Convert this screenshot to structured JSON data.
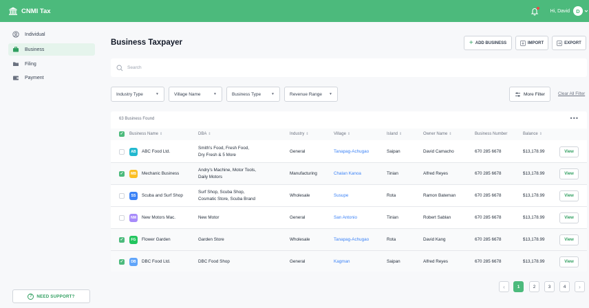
{
  "app": {
    "title": "CNMI Tax",
    "greeting": "Hi, David",
    "avatar_initial": "D",
    "accent": "#4cba7c"
  },
  "sidebar": {
    "items": [
      {
        "label": "Individual",
        "icon": "user-icon",
        "active": false
      },
      {
        "label": "Business",
        "icon": "briefcase-icon",
        "active": true
      },
      {
        "label": "Filing",
        "icon": "folder-icon",
        "active": false
      },
      {
        "label": "Payment",
        "icon": "wallet-icon",
        "active": false
      }
    ],
    "support_label": "NEED SUPPORT?"
  },
  "page": {
    "title": "Business Taxpayer",
    "add_label": "ADD BUSINESS",
    "import_label": "IMPORT",
    "export_label": "EXPORT"
  },
  "search": {
    "placeholder": "Search"
  },
  "filters": {
    "items": [
      "Industry Type",
      "Village Name",
      "Business Type",
      "Revenue Range"
    ],
    "more_label": "More Filter",
    "clear_label": "Clear All Filter"
  },
  "table": {
    "found_label": "63 Business Found",
    "columns": [
      "Business Name",
      "DBA",
      "Industry",
      "Village",
      "Island",
      "Owner Name",
      "Business Number",
      "Balance"
    ],
    "view_label": "View",
    "rows": [
      {
        "checked": false,
        "abbr": "AB",
        "abbr_color": "#22b8cf",
        "name": "ABC Food Ltd.",
        "dba1": "Smith's Food, Fresh Food,",
        "dba2": "Dry Fresh & 5 More",
        "industry": "General",
        "village": "Tanapag-Achugao",
        "island": "Saipan",
        "owner": "David Camacho",
        "number": "670 285 6678",
        "balance": "$13,178.99"
      },
      {
        "checked": true,
        "abbr": "MB",
        "abbr_color": "#fbbf24",
        "name": "Mechanic Business",
        "dba1": "Andry's Machine, Motor Tools,",
        "dba2": "Daily Motors",
        "industry": "Manufacturing",
        "village": "Chalan Kanoa",
        "island": "Tinian",
        "owner": "Alfred Reyes",
        "number": "670 285 6678",
        "balance": "$13,178.99"
      },
      {
        "checked": false,
        "abbr": "SS",
        "abbr_color": "#3b82f6",
        "name": "Scuba and Surf Shop",
        "dba1": "Surf Shop, Scuba Shop,",
        "dba2": "Cosmatic Store, Scuba Brand",
        "industry": "Wholesale",
        "village": "Susupe",
        "island": "Rota",
        "owner": "Ramon Bateman",
        "number": "670 285 6678",
        "balance": "$13,178.99"
      },
      {
        "checked": false,
        "abbr": "NM",
        "abbr_color": "#a78bfa",
        "name": "New Motors Mac.",
        "dba1": "New Motor",
        "dba2": "",
        "industry": "General",
        "village": "San Antonio",
        "island": "Tinian",
        "owner": "Robert Sablan",
        "number": "670 285 6678",
        "balance": "$13,178.99"
      },
      {
        "checked": true,
        "abbr": "FG",
        "abbr_color": "#22c55e",
        "name": "Flower Garden",
        "dba1": "Garden Store",
        "dba2": "",
        "industry": "Wholesale",
        "village": "Tanapag-Achugao",
        "island": "Rota",
        "owner": "David Kang",
        "number": "670 285 6678",
        "balance": "$13,178.99"
      },
      {
        "checked": true,
        "abbr": "DB",
        "abbr_color": "#60a5fa",
        "name": "DBC Food Ltd.",
        "dba1": "DBC Food Shop",
        "dba2": "",
        "industry": "General",
        "village": "Kagman",
        "island": "Saipan",
        "owner": "Alfred Reyes",
        "number": "670 285 6678",
        "balance": "$13,178.99"
      }
    ]
  },
  "pagination": {
    "pages": [
      "1",
      "2",
      "3",
      "4"
    ],
    "current": "1",
    "prev": "‹",
    "next": "›"
  }
}
